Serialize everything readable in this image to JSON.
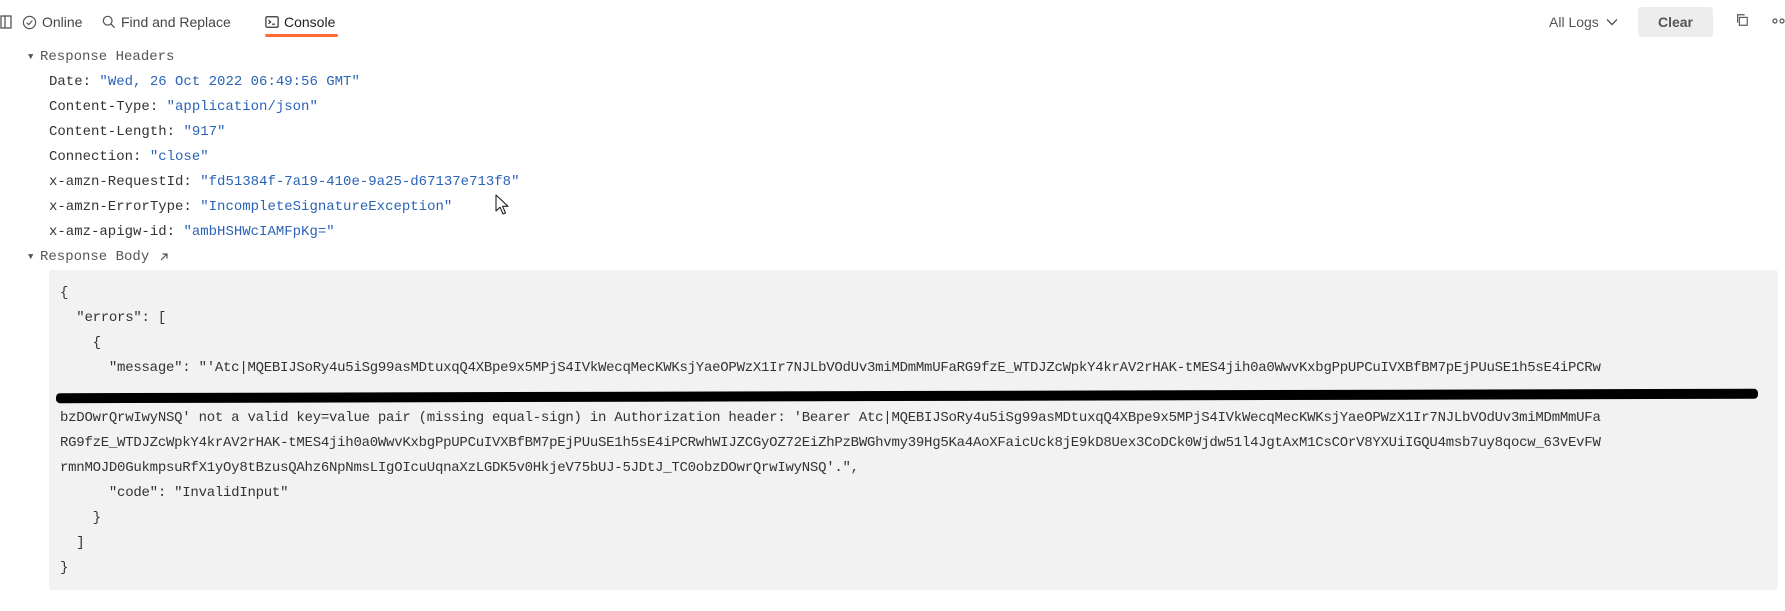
{
  "toolbar": {
    "online_label": "Online",
    "find_replace_label": "Find and Replace",
    "console_label": "Console",
    "all_logs_label": "All Logs",
    "clear_label": "Clear",
    "accent_color": "#ff6c37"
  },
  "response_headers": {
    "title": "Response Headers",
    "headers": [
      {
        "key": "Date:",
        "value": "\"Wed, 26 Oct 2022 06:49:56 GMT\""
      },
      {
        "key": "Content-Type:",
        "value": "\"application/json\""
      },
      {
        "key": "Content-Length:",
        "value": "\"917\""
      },
      {
        "key": "Connection:",
        "value": "\"close\""
      },
      {
        "key": "x-amzn-RequestId:",
        "value": "\"fd51384f-7a19-410e-9a25-d67137e713f8\""
      },
      {
        "key": "x-amzn-ErrorType:",
        "value": "\"IncompleteSignatureException\""
      },
      {
        "key": "x-amz-apigw-id:",
        "value": "\"ambHSHWcIAMFpKg=\""
      }
    ]
  },
  "response_body": {
    "title": "Response Body",
    "lines": [
      "{",
      "  \"errors\": [",
      "    {",
      "      \"message\": \"'Atc|MQEBIJSoRy4u5iSg99asMDtuxqQ4XBpe9x5MPjS4IVkWecqMecKWKsjYaeOPWzX1Ir7NJLbVOdUv3miMDmMmUFaRG9fzE_WTDJZcWpkY4krAV2rHAK-tMES4jih0a0WwvKxbgPpUPCuIVXBfBM7pEjPUuSE1h5sE4iPCRw",
      "",
      "bzDOwrQrwIwyNSQ' not a valid key=value pair (missing equal-sign) in Authorization header: 'Bearer Atc|MQEBIJSoRy4u5iSg99asMDtuxqQ4XBpe9x5MPjS4IVkWecqMecKWKsjYaeOPWzX1Ir7NJLbVOdUv3miMDmMmUFa",
      "RG9fzE_WTDJZcWpkY4krAV2rHAK-tMES4jih0a0WwvKxbgPpUPCuIVXBfBM7pEjPUuSE1h5sE4iPCRwhWIJZCGyOZ72EiZhPzBWGhvmy39Hg5Ka4AoXFaicUck8jE9kD8Uex3CoDCk0Wjdw51l4JgtAxM1CsCOrV8YXUiIGQU4msb7uy8qocw_63vEvFW",
      "rmnMOJD0GukmpsuRfX1yOy8tBzusQAhz6NpNmsLIgOIcuUqnaXzLGDK5v0HkjeV75bUJ-5JDtJ_TC0obzDOwrQrwIwyNSQ'.\",",
      "      \"code\": \"InvalidInput\"",
      "    }",
      "  ]",
      "}"
    ]
  }
}
